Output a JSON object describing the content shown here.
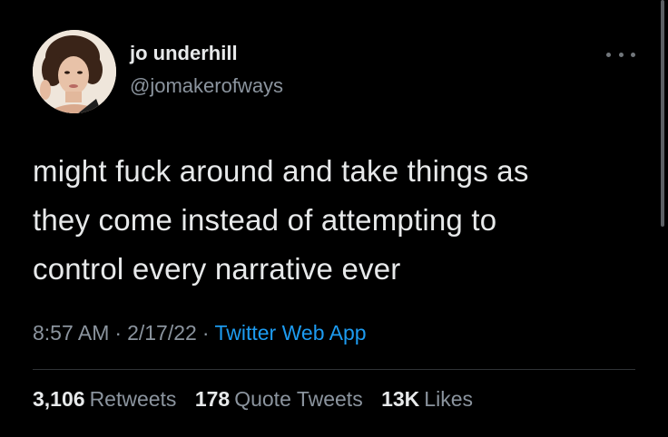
{
  "user": {
    "display_name": "jo underhill",
    "handle": "@jomakerofways"
  },
  "tweet": {
    "text": "might fuck around and take things as\nthey come instead of attempting to\ncontrol every narrative ever",
    "time": "8:57 AM",
    "date": "2/17/22",
    "separator": "·",
    "source": "Twitter Web App"
  },
  "stats": {
    "retweets_count": "3,106",
    "retweets_label": "Retweets",
    "quotes_count": "178",
    "quotes_label": "Quote Tweets",
    "likes_count": "13K",
    "likes_label": "Likes"
  },
  "icons": {
    "more": "more-horizontal-icon"
  },
  "colors": {
    "background": "#000000",
    "text": "#e7e9ea",
    "muted": "#8b949e",
    "link": "#1d9bf0"
  }
}
